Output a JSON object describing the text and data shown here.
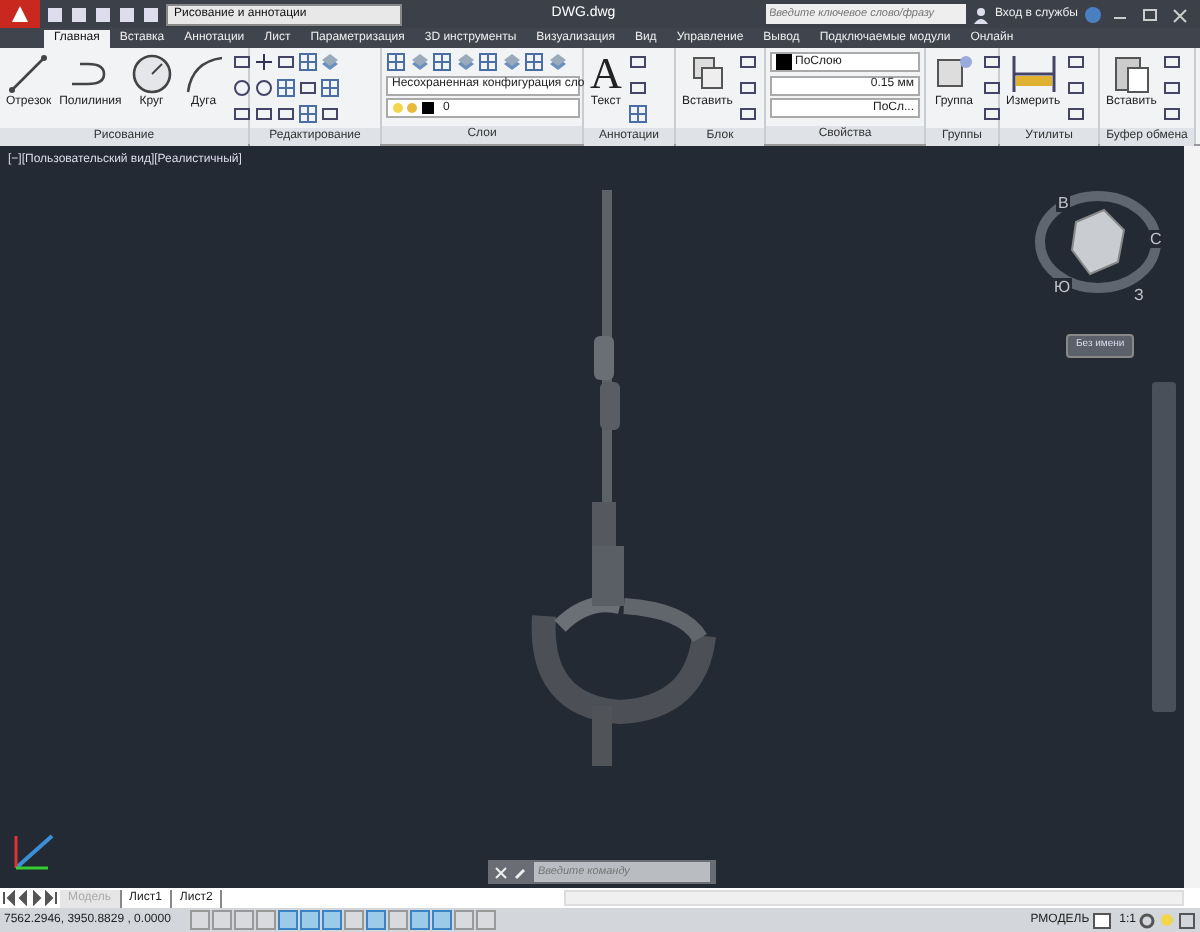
{
  "title_bar": {
    "workspace": "Рисование и аннотации",
    "title": "DWG.dwg",
    "search_placeholder": "Введите ключевое слово/фразу",
    "sign_in": "Вход в службы"
  },
  "ribbon_tabs": [
    {
      "label": "Главная",
      "selected": true
    },
    {
      "label": "Вставка",
      "selected": false
    },
    {
      "label": "Аннотации",
      "selected": false
    },
    {
      "label": "Лист",
      "selected": false
    },
    {
      "label": "Параметризация",
      "selected": false
    },
    {
      "label": "3D инструменты",
      "selected": false
    },
    {
      "label": "Визуализация",
      "selected": false
    },
    {
      "label": "Вид",
      "selected": false
    },
    {
      "label": "Управление",
      "selected": false
    },
    {
      "label": "Вывод",
      "selected": false
    },
    {
      "label": "Подключаемые модули",
      "selected": false
    },
    {
      "label": "Онлайн",
      "selected": false
    }
  ],
  "ribbon_panels": [
    {
      "title": "Рисование",
      "buttons": [
        {
          "kind": "line",
          "label": "Отрезок"
        },
        {
          "kind": "polyline",
          "label": "Полилиния"
        },
        {
          "kind": "circle",
          "label": "Круг"
        },
        {
          "kind": "arc",
          "label": "Дуга"
        }
      ]
    },
    {
      "title": "Редактирование"
    },
    {
      "title": "Слои",
      "layer_dropdown": "Несохраненная конфигурация сло",
      "current_layer": "0"
    },
    {
      "title": "Аннотации",
      "buttons": [
        {
          "kind": "text",
          "label": "Текст",
          "glyph": "A"
        }
      ]
    },
    {
      "title": "Блок",
      "buttons": [
        {
          "kind": "insert",
          "label": "Вставить"
        }
      ]
    },
    {
      "title": "Свойства",
      "color_value": "ПоСлою",
      "lineweight": "0.15 мм",
      "linetype": "ПоСл..."
    },
    {
      "title": "Группы",
      "buttons": [
        {
          "kind": "group",
          "label": "Группа"
        }
      ]
    },
    {
      "title": "Утилиты",
      "buttons": [
        {
          "kind": "measure",
          "label": "Измерить"
        }
      ]
    },
    {
      "title": "Буфер обмена",
      "buttons": [
        {
          "kind": "paste",
          "label": "Вставить"
        }
      ]
    }
  ],
  "viewport": {
    "label": "[−][Пользовательский вид][Реалистичный]",
    "compass": [
      "В",
      "С",
      "Ю",
      "З"
    ],
    "view_dropdown": "Без имени"
  },
  "command_line": {
    "placeholder": "Введите команду"
  },
  "layout_tabs": [
    {
      "label": "Модель",
      "selected": true
    },
    {
      "label": "Лист1",
      "selected": false
    },
    {
      "label": "Лист2",
      "selected": false
    }
  ],
  "status_bar": {
    "coordinates": "7562.2946, 3950.8829 , 0.0000",
    "toggles": [
      {
        "on": false
      },
      {
        "on": false
      },
      {
        "on": false
      },
      {
        "on": false
      },
      {
        "on": true
      },
      {
        "on": true
      },
      {
        "on": true
      },
      {
        "on": false
      },
      {
        "on": true
      },
      {
        "on": false
      },
      {
        "on": true
      },
      {
        "on": true
      },
      {
        "on": false
      },
      {
        "on": false
      }
    ],
    "space": "РМОДЕЛЬ",
    "scale": "1:1"
  }
}
